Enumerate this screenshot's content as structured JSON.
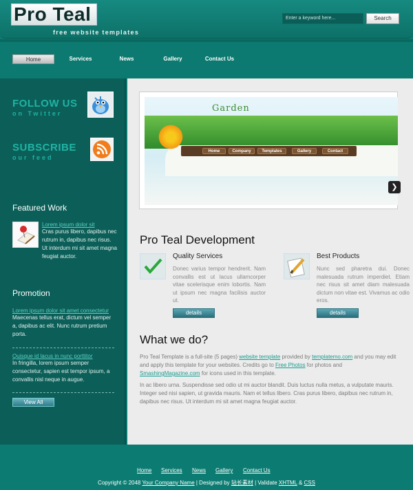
{
  "header": {
    "logo": "Pro Teal",
    "tagline": "free website templates",
    "search_placeholder": "Enter a keyword here...",
    "search_button": "Search"
  },
  "nav": [
    "Home",
    "Services",
    "News",
    "Gallery",
    "Contact Us"
  ],
  "sidebar": {
    "follow_title": "FOLLOW US",
    "follow_sub": "on Twitter",
    "subscribe_title": "SUBSCRIBE",
    "subscribe_sub": "our feed",
    "featured_heading": "Featured Work",
    "featured_link": "Lorem ipsum dolor sit",
    "featured_text": "Cras purus libero, dapibus nec rutrum in, dapibus nec risus. Ut interdum mi sit amet magna feugiat auctor.",
    "promotion_heading": "Promotion",
    "promo1_link": "Lorem ipsum dolor sit amet consectetur",
    "promo1_text": "Maecenas tellus erat, dictum vel semper a, dapibus ac elit. Nunc rutrum pretium porta.",
    "promo2_link": "Quisque id lacus in nunc porttitor",
    "promo2_text": "In fringilla, lorem ipsum semper consectetur, sapien est tempor ipsum, a convallis nisl neque in augue.",
    "view_all": "View All"
  },
  "banner": {
    "title": "Garden",
    "nav": [
      "Home",
      "Company",
      "Templates",
      "Gallery",
      "Contact"
    ]
  },
  "main": {
    "title": "Pro Teal Development",
    "col1_title": "Quality Services",
    "col1_text": "Donec varius tempor hendrerit. Nam convallis est ut lacus ullamcorper vitae scelerisque enim lobortis. Nam ut ipsum nec magna facilisis auctor ut.",
    "col2_title": "Best Products",
    "col2_text": "Nunc sed pharetra dui. Donec malesuada rutrum imperdiet. Etiam nec risus sit amet diam malesuada dictum non vitae est. Vivamus ac odio eros.",
    "details": "details",
    "what_title": "What we do?",
    "p1_a": "Pro Teal Template is a full-site (5 pages) ",
    "p1_link1": "website template",
    "p1_b": " provided by ",
    "p1_link2": "templatemo.com",
    "p1_c": " and you may edit and apply this template for your websites. Credits go to ",
    "p1_link3": "Free Photos",
    "p1_d": " for photos and ",
    "p1_link4": "SmashingMagazine.com",
    "p1_e": " for icons used in this template.",
    "p2": "In ac libero urna. Suspendisse sed odio ut mi auctor blandit. Duis luctus nulla metus, a vulputate mauris. Integer sed nisi sapien, ut gravida mauris. Nam et tellus libero. Cras purus libero, dapibus nec rutrum in, dapibus nec risus. Ut interdum mi sit amet magna feugiat auctor."
  },
  "footer": {
    "links": [
      "Home",
      "Services",
      "News",
      "Gallery",
      "Contact Us"
    ],
    "copy_a": "Copyright © 2048 ",
    "copy_link1": "Your Company Name",
    "copy_b": " | Designed by ",
    "copy_link2": "站长素材",
    "copy_c": " | Validate ",
    "copy_link3": "XHTML",
    "copy_d": " & ",
    "copy_link4": "CSS"
  }
}
